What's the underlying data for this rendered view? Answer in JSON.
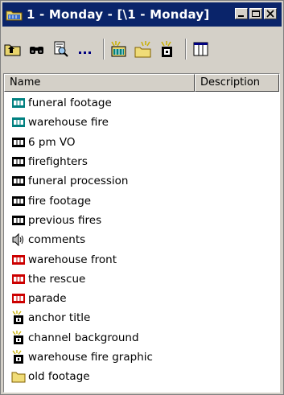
{
  "window": {
    "title": "1 - Monday - [\\1 - Monday]"
  },
  "toolbar": {
    "buttons": [
      {
        "icon": "up-folder-icon"
      },
      {
        "icon": "find-icon"
      },
      {
        "icon": "preview-icon"
      },
      {
        "icon": "ellipsis-icon"
      },
      {
        "icon": "new-bin-icon"
      },
      {
        "icon": "new-folder-icon"
      },
      {
        "icon": "new-title-icon"
      },
      {
        "icon": "view-columns-icon"
      }
    ]
  },
  "list": {
    "columns": [
      "Name",
      "Description"
    ],
    "items": [
      {
        "name": "funeral footage",
        "type": "teal-clip"
      },
      {
        "name": "warehouse fire",
        "type": "teal-clip"
      },
      {
        "name": "6 pm VO",
        "type": "black-clip"
      },
      {
        "name": "firefighters",
        "type": "black-clip"
      },
      {
        "name": "funeral procession",
        "type": "black-clip"
      },
      {
        "name": "fire footage",
        "type": "black-clip"
      },
      {
        "name": "previous fires",
        "type": "black-clip"
      },
      {
        "name": "comments",
        "type": "audio"
      },
      {
        "name": "warehouse front",
        "type": "red-clip"
      },
      {
        "name": "the rescue",
        "type": "red-clip"
      },
      {
        "name": "parade",
        "type": "red-clip"
      },
      {
        "name": "anchor title",
        "type": "title"
      },
      {
        "name": "channel background",
        "type": "title"
      },
      {
        "name": "warehouse fire graphic",
        "type": "title"
      },
      {
        "name": "old footage",
        "type": "folder"
      }
    ]
  },
  "colors": {
    "titlebar": "#0a246a",
    "teal": "#008080",
    "red": "#cc0000",
    "chrome": "#d4d0c8"
  }
}
